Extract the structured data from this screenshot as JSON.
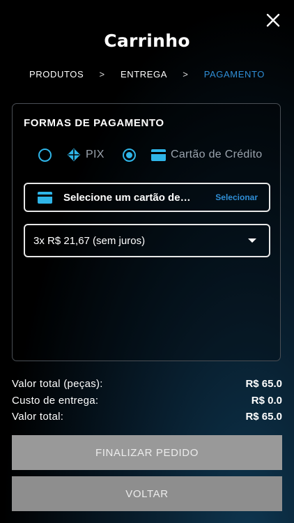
{
  "header": {
    "title": "Carrinho",
    "close_icon": "close-icon"
  },
  "steps": {
    "items": [
      "PRODUTOS",
      "ENTREGA",
      "PAGAMENTO"
    ],
    "separator": ">",
    "active_index": 2
  },
  "payment": {
    "section_title": "FORMAS DE PAGAMENTO",
    "methods": [
      {
        "label": "PIX",
        "icon": "pix-icon",
        "selected": false
      },
      {
        "label": "Cartão de Crédito",
        "icon": "credit-card-icon",
        "selected": true
      }
    ],
    "card_selector": {
      "text": "Selecione um cartão de crédito",
      "action": "Selecionar",
      "icon": "credit-card-icon"
    },
    "installments": {
      "selected": "3x R$ 21,67 (sem juros)"
    }
  },
  "summary": {
    "rows": [
      {
        "label": "Valor total (peças):",
        "amount": "R$ 65.0"
      },
      {
        "label": "Custo de entrega:",
        "amount": "R$ 0.0"
      },
      {
        "label": "Valor total:",
        "amount": "R$ 65.0"
      }
    ]
  },
  "buttons": {
    "finish": "FINALIZAR PEDIDO",
    "back": "VOLTAR"
  },
  "colors": {
    "accent": "#2fb5e8",
    "link": "#2f8ed6",
    "button_disabled": "#999999"
  }
}
